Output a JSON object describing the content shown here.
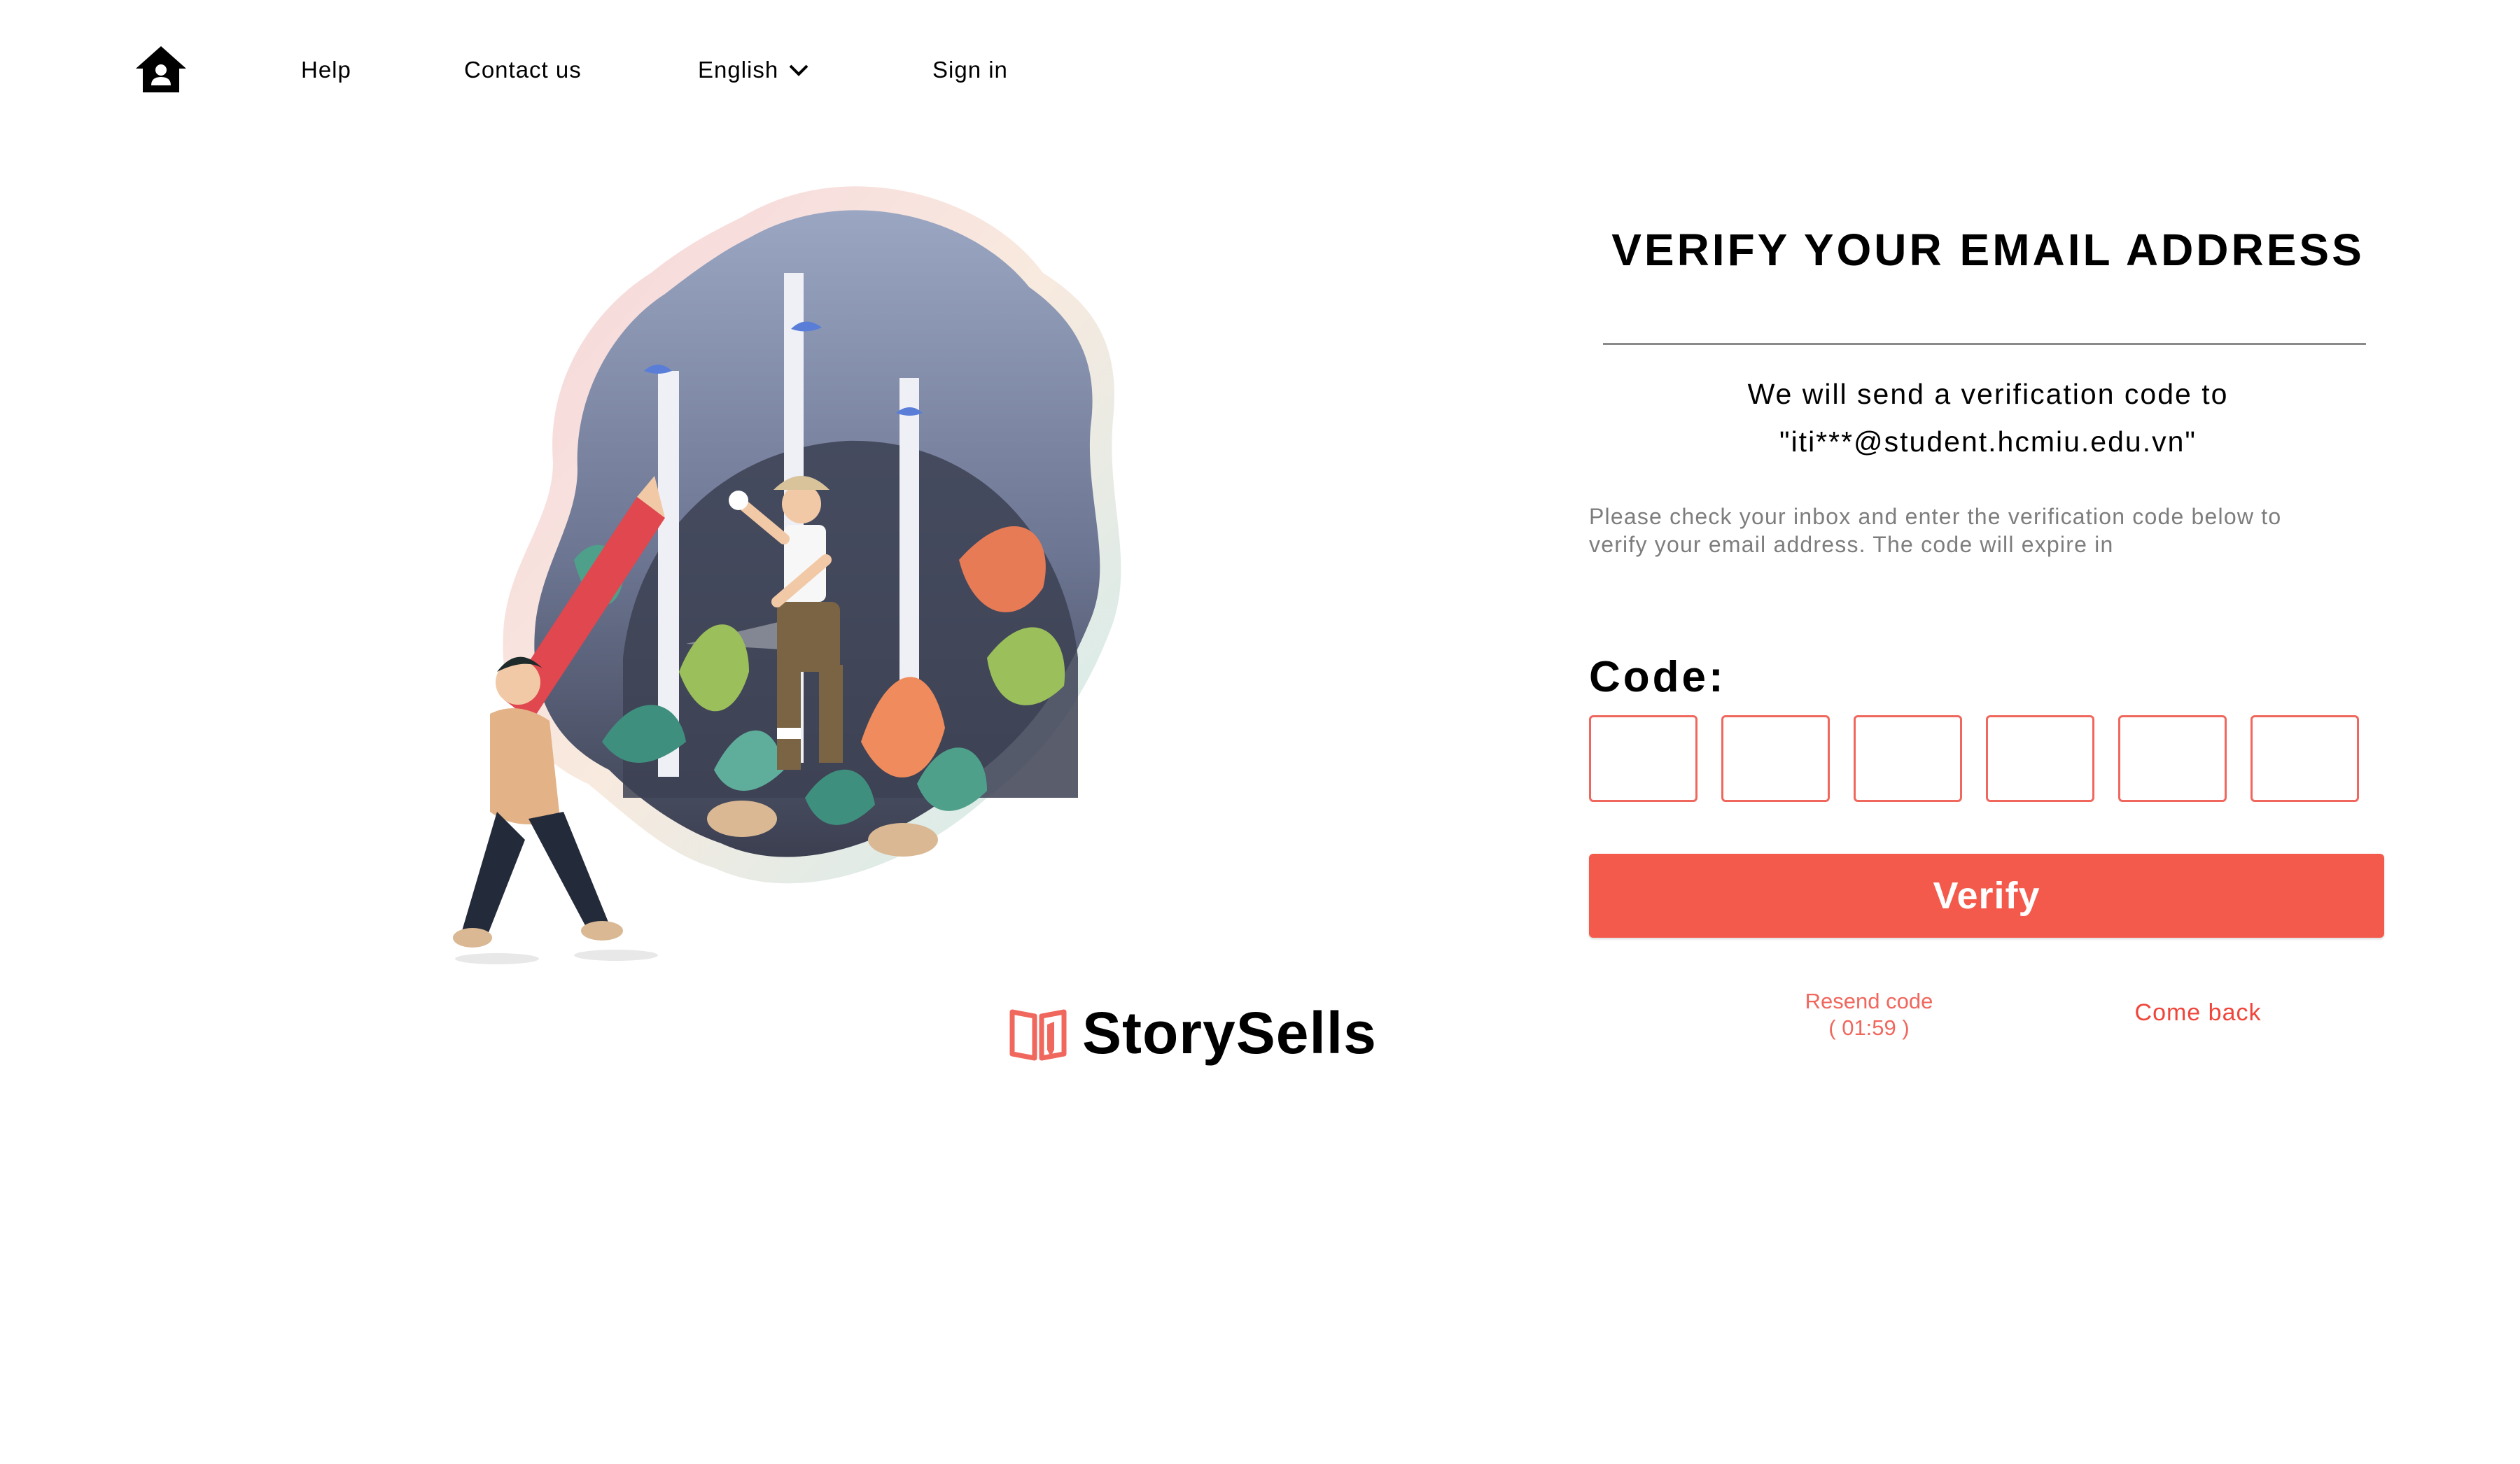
{
  "nav": {
    "home_icon": "home-icon",
    "help": "Help",
    "contact": "Contact us",
    "language": "English",
    "language_icon": "chevron-down-icon",
    "sign_in": "Sign in"
  },
  "brand": {
    "name": "StorySells",
    "logo_icon": "book-pencil-icon",
    "logo_color": "#f0675d"
  },
  "form": {
    "title": "VERIFY YOUR EMAIL ADDRESS",
    "send_line_1": "We will send a verification code to",
    "send_line_2": "\"iti***@student.hcmiu.edu.vn\"",
    "info": "Please check your inbox and enter the verification code below to verify your email address. The code will expire in",
    "code_label": "Code:",
    "code_values": [
      "",
      "",
      "",
      "",
      "",
      ""
    ],
    "verify_label": "Verify",
    "resend_label": "Resend code",
    "resend_timer": "( 01:59 )",
    "come_back_label": "Come back"
  },
  "colors": {
    "accent": "#f45a4b",
    "box_border": "#f0675d",
    "muted_text": "#7d7d7d"
  }
}
